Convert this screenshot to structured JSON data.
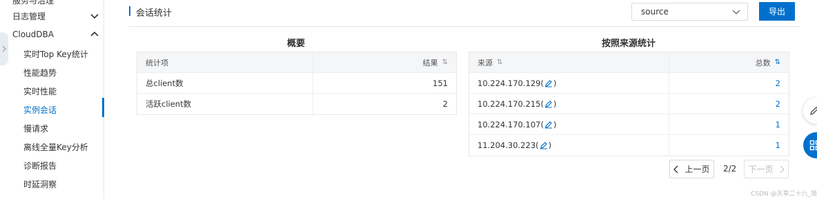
{
  "sidebar": {
    "cut_item": "服务与治理",
    "groups": [
      {
        "label": "日志管理"
      },
      {
        "label": "CloudDBA"
      }
    ],
    "items": [
      {
        "label": "实时Top Key统计"
      },
      {
        "label": "性能趋势"
      },
      {
        "label": "实时性能"
      },
      {
        "label": "实例会话"
      },
      {
        "label": "慢请求"
      },
      {
        "label": "离线全量Key分析"
      },
      {
        "label": "诊断报告"
      },
      {
        "label": "时延洞察"
      }
    ],
    "active_item": "实例会话"
  },
  "header": {
    "title": "会话统计",
    "select_value": "source",
    "export_label": "导出"
  },
  "summary": {
    "title": "概要",
    "columns": [
      "统计项",
      "结果"
    ],
    "rows": [
      {
        "name": "总client数",
        "value": "151"
      },
      {
        "name": "活跃client数",
        "value": "2"
      }
    ]
  },
  "by_source": {
    "title": "按照来源统计",
    "columns": [
      "来源",
      "总数"
    ],
    "rows": [
      {
        "source_ip": "10.224.170.129",
        "count": "2"
      },
      {
        "source_ip": "10.224.170.215",
        "count": "2"
      },
      {
        "source_ip": "10.224.170.107",
        "count": "1"
      },
      {
        "source_ip": "11.204.30.223",
        "count": "1"
      }
    ]
  },
  "pagination": {
    "prev_label": "上一页",
    "page_indicator": "2/2",
    "next_label": "下一页"
  },
  "watermark": "CSDN @天草二十六_简村人",
  "colors": {
    "accent": "#0070cc",
    "header_bg": "#f5f6f8",
    "border": "#e8e8e8"
  }
}
